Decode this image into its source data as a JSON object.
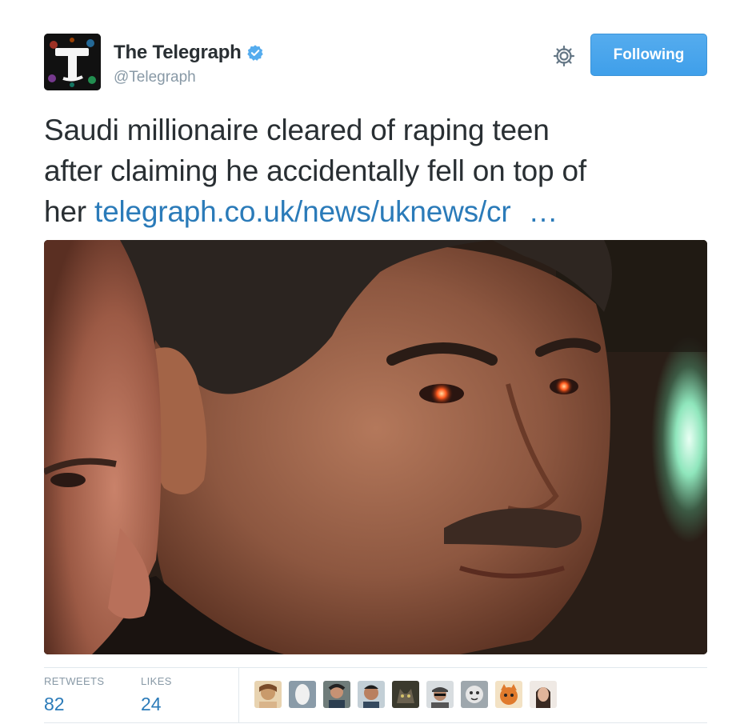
{
  "account": {
    "display_name": "The Telegraph",
    "handle": "@Telegraph",
    "verified": true,
    "avatar_icon": "telegraph-t-logo-icon",
    "verified_icon": "verified-badge-icon"
  },
  "actions": {
    "settings_icon": "gear-icon",
    "follow_label": "Following"
  },
  "tweet": {
    "line1": "Saudi millionaire cleared of raping teen",
    "line2": "after claiming he accidentally fell on top of",
    "line3_text": "her",
    "link_text": "telegraph.co.uk/news/uknews/cr",
    "link_ellipsis": "…"
  },
  "media": {
    "type": "photo"
  },
  "stats": {
    "retweets_label": "RETWEETS",
    "retweets_count": "82",
    "likes_label": "LIKES",
    "likes_count": "24",
    "liker_avatars_count": 9
  },
  "colors": {
    "follow_button": "#55acee",
    "link": "#2b7bb9",
    "muted_text": "#8899a6",
    "verified": "#55acee"
  }
}
